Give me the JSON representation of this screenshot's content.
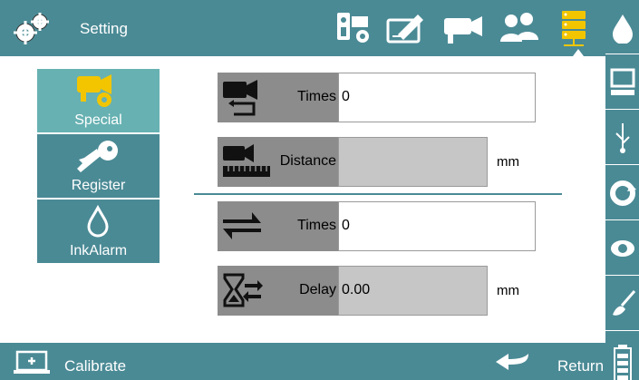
{
  "header": {
    "title": "Setting",
    "icons": [
      "camera-gear-icon",
      "pen-card-icon",
      "camera-icon",
      "users-icon",
      "server-icon"
    ]
  },
  "tabs": [
    {
      "label": "Special",
      "active": true
    },
    {
      "label": "Register",
      "active": false
    },
    {
      "label": "InkAlarm",
      "active": false
    }
  ],
  "rows": [
    {
      "label": "Times",
      "value": "0",
      "unit": ""
    },
    {
      "label": "Distance",
      "value": "",
      "unit": "mm"
    },
    {
      "label": "Times",
      "value": "0",
      "unit": ""
    },
    {
      "label": "Delay",
      "value": "0.00",
      "unit": "mm"
    }
  ],
  "sidebar": {
    "icons": [
      "ink-drop-icon",
      "monitor-icon",
      "usb-icon",
      "refresh-icon",
      "eye-icon",
      "brush-icon",
      "battery-icon"
    ]
  },
  "footer": {
    "calibrate_label": "Calibrate",
    "return_label": "Return"
  },
  "colors": {
    "bar": "#4a8a95",
    "active_tab": "#67b1b2",
    "accent_icon": "#f2c500"
  }
}
